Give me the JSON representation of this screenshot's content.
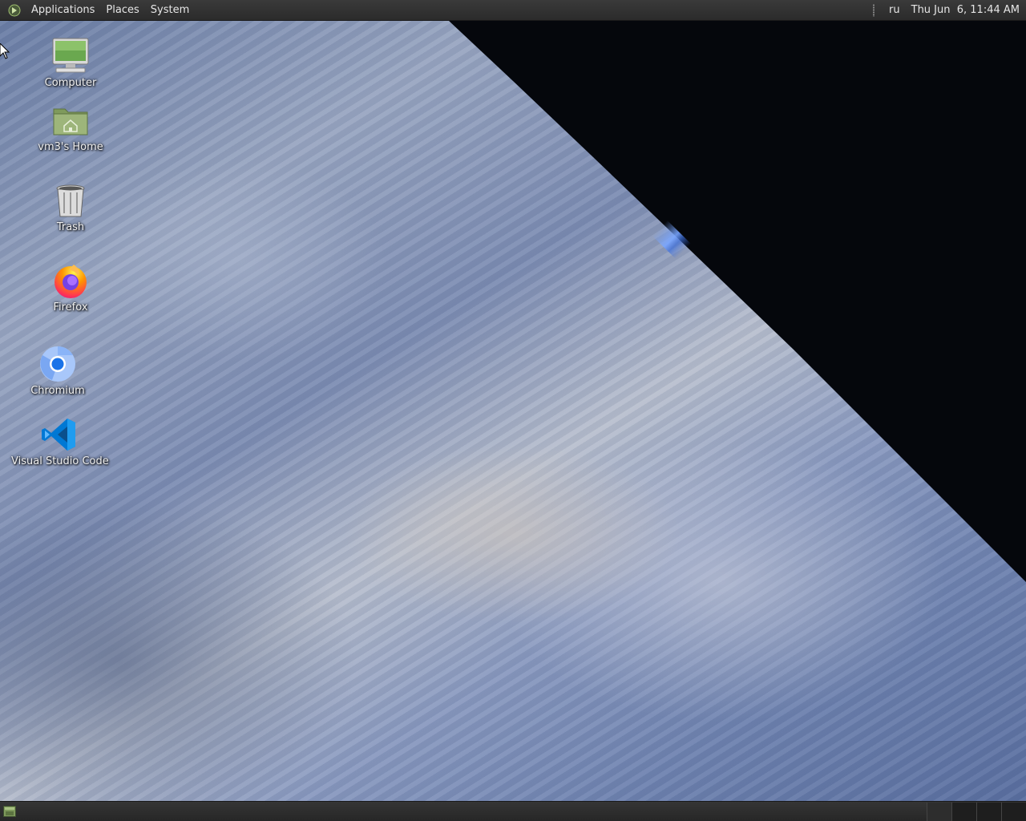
{
  "top_panel": {
    "menus": [
      "Applications",
      "Places",
      "System"
    ],
    "keyboard_layout": "ru",
    "clock": "Thu Jun  6, 11:44 AM"
  },
  "desktop_icons": [
    {
      "label": "Computer",
      "icon": "computer-icon"
    },
    {
      "label": "vm3's Home",
      "icon": "home-folder-icon"
    },
    {
      "label": "Trash",
      "icon": "trash-icon"
    },
    {
      "label": "Firefox",
      "icon": "firefox-icon"
    },
    {
      "label": "Chromium",
      "icon": "chromium-icon"
    },
    {
      "label": "Visual Studio Code",
      "icon": "vscode-icon"
    }
  ],
  "bottom_panel": {
    "show_desktop_icon": "show-desktop-icon",
    "workspaces": 4,
    "active_workspace": 1
  },
  "colors": {
    "panel": "#2b2b2b",
    "panel_text": "#e6e6e6",
    "space": "#05070c",
    "atmosphere": "#3c6edc"
  }
}
